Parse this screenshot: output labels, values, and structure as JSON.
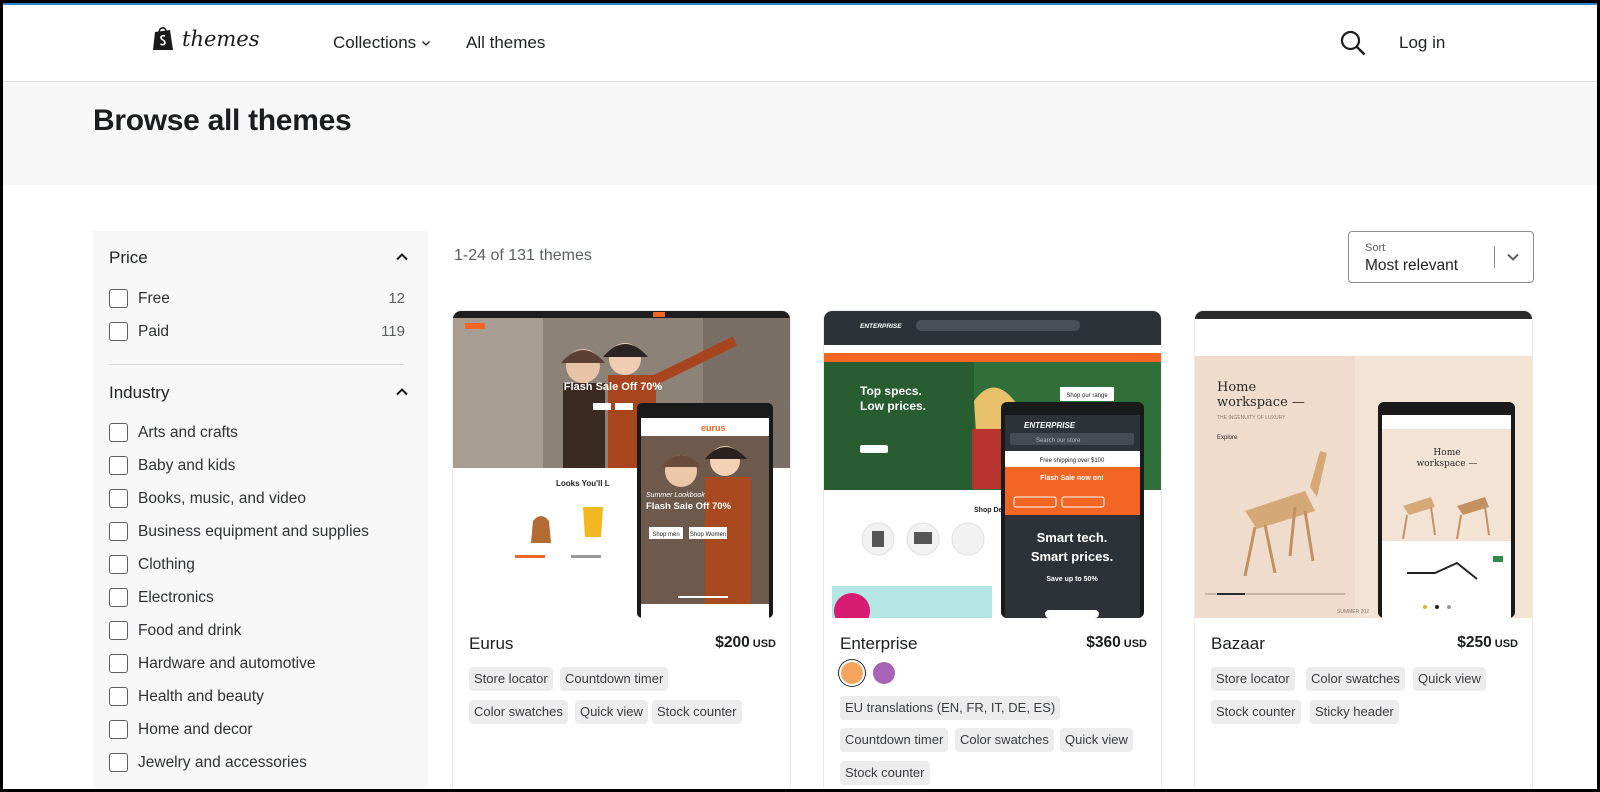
{
  "header": {
    "logo_text": "themes",
    "nav": {
      "collections": "Collections",
      "all_themes": "All themes"
    },
    "login": "Log in"
  },
  "page": {
    "title": "Browse all themes"
  },
  "filters": {
    "price": {
      "title": "Price",
      "options": [
        {
          "label": "Free",
          "count": "12"
        },
        {
          "label": "Paid",
          "count": "119"
        }
      ]
    },
    "industry": {
      "title": "Industry",
      "options": [
        {
          "label": "Arts and crafts"
        },
        {
          "label": "Baby and kids"
        },
        {
          "label": "Books, music, and video"
        },
        {
          "label": "Business equipment and supplies"
        },
        {
          "label": "Clothing"
        },
        {
          "label": "Electronics"
        },
        {
          "label": "Food and drink"
        },
        {
          "label": "Hardware and automotive"
        },
        {
          "label": "Health and beauty"
        },
        {
          "label": "Home and decor"
        },
        {
          "label": "Jewelry and accessories"
        }
      ]
    }
  },
  "results": {
    "count_text": "1-24 of 131 themes",
    "sort": {
      "caption": "Sort",
      "value": "Most relevant"
    }
  },
  "themes": [
    {
      "name": "Eurus",
      "price": "$200",
      "currency": "USD",
      "tags": [
        "Store locator",
        "Countdown timer",
        "Color swatches",
        "Quick view",
        "Stock counter"
      ],
      "preview": {
        "headline": "Flash Sale Off 70%",
        "section": "Looks You'll L",
        "mobile_brand": "eurus",
        "mobile_sub": "Summer Lookbook",
        "mobile_headline": "Flash Sale Off 70%",
        "btn1": "Shop men",
        "btn2": "Shop Women"
      }
    },
    {
      "name": "Enterprise",
      "price": "$360",
      "currency": "USD",
      "swatches": [
        "#f5a45d",
        "#a764b6"
      ],
      "tags": [
        "EU translations (EN, FR, IT, DE, ES)",
        "Countdown timer",
        "Color swatches",
        "Quick view",
        "Stock counter"
      ],
      "preview": {
        "brand": "ENTERPRISE",
        "headline1": "Top specs.",
        "headline2": "Low prices.",
        "cta": "Shop our range",
        "section": "Shop Deal",
        "mobile_flash": "Flash Sale now on!",
        "mobile_h1": "Smart tech.",
        "mobile_h2": "Smart prices.",
        "mobile_save": "Save up to 50%",
        "search_ph": "Search our store",
        "shipping": "Free shipping over $100"
      }
    },
    {
      "name": "Bazaar",
      "price": "$250",
      "currency": "USD",
      "tags": [
        "Store locator",
        "Color swatches",
        "Quick view",
        "Stock counter",
        "Sticky header"
      ],
      "preview": {
        "headline1": "Home",
        "headline2": "workspace —",
        "tagline": "THE INGENUITY OF LUXURY",
        "explore": "Explore",
        "summer": "SUMMER 202"
      }
    }
  ],
  "colors": {
    "accent_orange": "#f26522",
    "enterprise_dark": "#2d3238"
  }
}
